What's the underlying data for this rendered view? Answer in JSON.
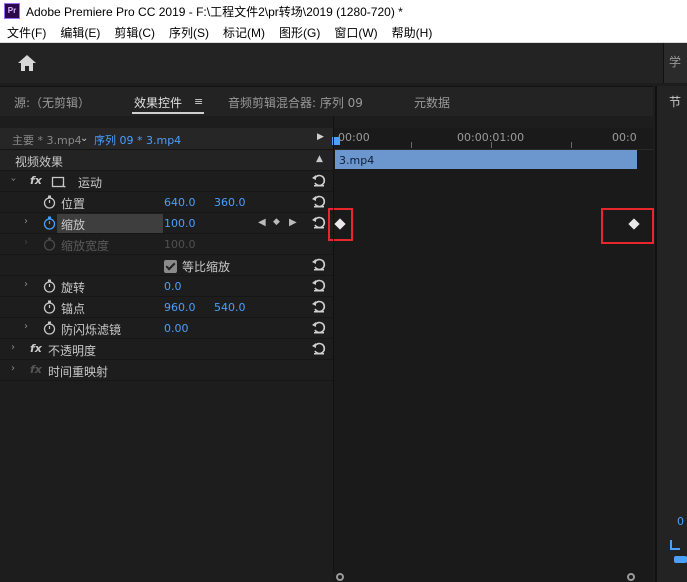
{
  "window": {
    "app_logo": "Pr",
    "title": "Adobe Premiere Pro CC 2019 - F:\\工程文件2\\pr转场\\2019 (1280-720)  *"
  },
  "menu": [
    "文件(F)",
    "编辑(E)",
    "剪辑(C)",
    "序列(S)",
    "标记(M)",
    "图形(G)",
    "窗口(W)",
    "帮助(H)"
  ],
  "toolbar": {
    "home_icon": "home-icon",
    "learn_tab": "学"
  },
  "tabs": {
    "source": "源:（无剪辑）",
    "effect_controls": "效果控件",
    "effect_controls_menu": "≡",
    "audio_mixer": "音频剪辑混合器: 序列 09",
    "metadata": "元数据"
  },
  "right_panel": {
    "tab": "节",
    "value": "0"
  },
  "source_row": {
    "main": "主要 * 3.mp4",
    "sequence": "序列 09 * 3.mp4"
  },
  "effects": {
    "video_effects": "视频效果",
    "motion": "运动",
    "position": {
      "label": "位置",
      "x": "640.0",
      "y": "360.0"
    },
    "scale": {
      "label": "缩放",
      "value": "100.0"
    },
    "scale_width": {
      "label": "缩放宽度",
      "value": "100.0"
    },
    "uniform_scale": {
      "label": "等比缩放",
      "checked": true
    },
    "rotation": {
      "label": "旋转",
      "value": "0.0"
    },
    "anchor": {
      "label": "锚点",
      "x": "960.0",
      "y": "540.0"
    },
    "anti_flicker": {
      "label": "防闪烁滤镜",
      "value": "0.00"
    },
    "opacity": "不透明度",
    "time_remap": "时间重映射"
  },
  "timeline": {
    "tc_start": "00:00",
    "tc_mid": "00:00:01:00",
    "tc_end": "00:0",
    "clip_name": "3.mp4"
  },
  "colors": {
    "accent": "#4a9fff",
    "clip": "#6b96ce",
    "highlight": "#e8262b"
  }
}
